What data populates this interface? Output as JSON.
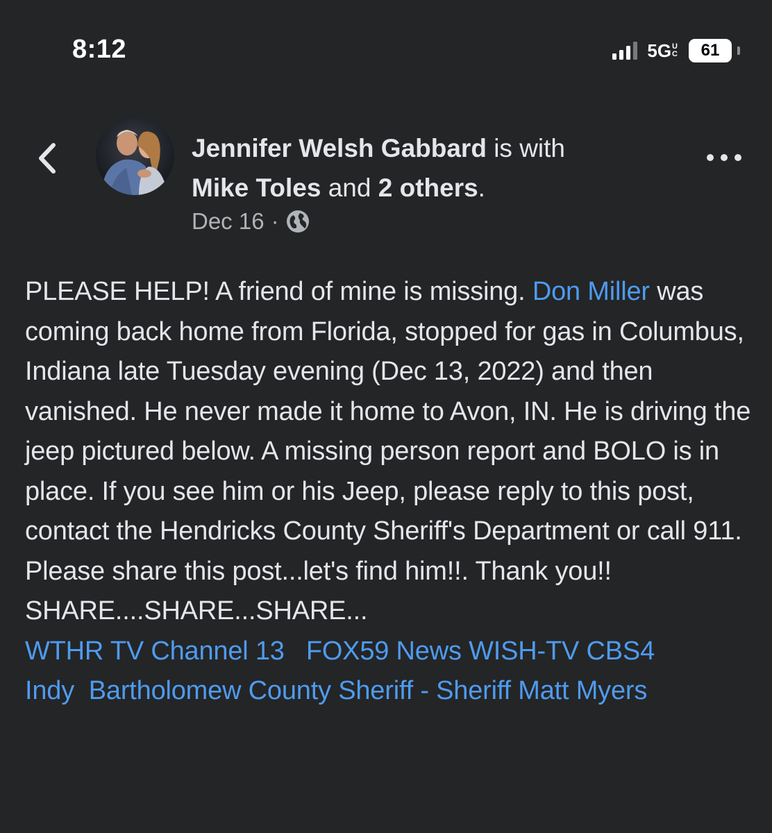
{
  "status_bar": {
    "time": "8:12",
    "network": "5G",
    "network_suffix_top": "U",
    "network_suffix_bottom": "C",
    "battery": "61"
  },
  "post": {
    "author": "Jennifer Welsh Gabbard",
    "with_text": " is with",
    "tagged_name": "Mike Toles",
    "and_text": " and ",
    "others_text": "2 others",
    "period": ".",
    "date": "Dec 16",
    "separator": "·",
    "body": {
      "p1": "PLEASE HELP! A friend of mine is missing. ",
      "mention": "Don Miller",
      "p2": " was coming back home from Florida, stopped for gas in Columbus, Indiana late Tuesday evening (Dec 13, 2022) and then vanished. He never made it home to Avon, IN. He is driving the jeep pictured below. A missing person report and BOLO is in place. If you see him or his Jeep, please reply to this post, contact the Hendricks County Sheriff's Department or call 911.",
      "line_share": "Please share this post...let's find him!!. Thank you!!",
      "line_share2": "SHARE....SHARE...SHARE...",
      "tags": [
        "WTHR TV Channel 13",
        "FOX59 News",
        "WISH-TV",
        "CBS4 Indy",
        "Bartholomew County Sheriff - Sheriff Matt Myers"
      ]
    }
  },
  "colors": {
    "background": "#242526",
    "text": "#e4e6eb",
    "secondary": "#b0b3b8",
    "link": "#4e9bf0"
  },
  "icons": [
    "chevron-left-icon",
    "avatar",
    "globe-icon",
    "more-icon",
    "signal-icon",
    "battery-icon"
  ]
}
